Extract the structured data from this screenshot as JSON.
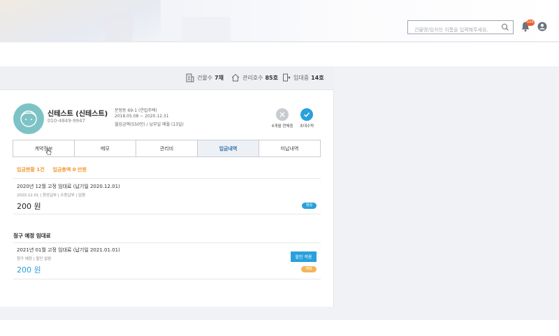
{
  "header": {
    "search": {
      "placeholder": "건물명/임차인 이름을 입력해주세요."
    },
    "notification_count": "109"
  },
  "stats": [
    {
      "icon": "building-icon",
      "label": "건물수",
      "value": "7채"
    },
    {
      "icon": "house-icon",
      "label": "관리호수",
      "value": "85호"
    },
    {
      "icon": "door-icon",
      "label": "임대중",
      "value": "14호"
    }
  ],
  "tenant": {
    "name": "신테스트 (신테스트)",
    "phone": "010-4849-9947",
    "address": "문정동 69-1 (연립주택)",
    "period": "2018.05.08 ~ 2020.12.31",
    "payment": "월입금액(550만) / 납부일 매월 (13일)",
    "action_cancel": "6개월 연체중",
    "action_confirm": "초대수락"
  },
  "tabs": [
    "계약정보",
    "메모",
    "관리비",
    "입금내역",
    "미납내역"
  ],
  "active_tab": 3,
  "summary": {
    "count": "입금현황 1건",
    "total": "입금총액 0 만원"
  },
  "deposit": {
    "title": "2020년 12월 고정 임대료 (납기일 2020.12.01)",
    "sub": "2020.12.01 | 정상납부 | 수동납부 | 없음",
    "amount": "200 원",
    "status": "정상"
  },
  "upcoming": {
    "section_title": "청구 예정 임대료",
    "title": "2021년 01월 고정 임대료 (납기일 2021.01.01)",
    "sub": "청구 예정 | 할인 없음",
    "amount": "200 원",
    "discount_button": "할인 적용",
    "status": "예정"
  },
  "colors": {
    "accent": "#2aa0dd",
    "orange": "#f0962a",
    "avatar": "#7dc3c6",
    "badge": "#f05a2a"
  }
}
